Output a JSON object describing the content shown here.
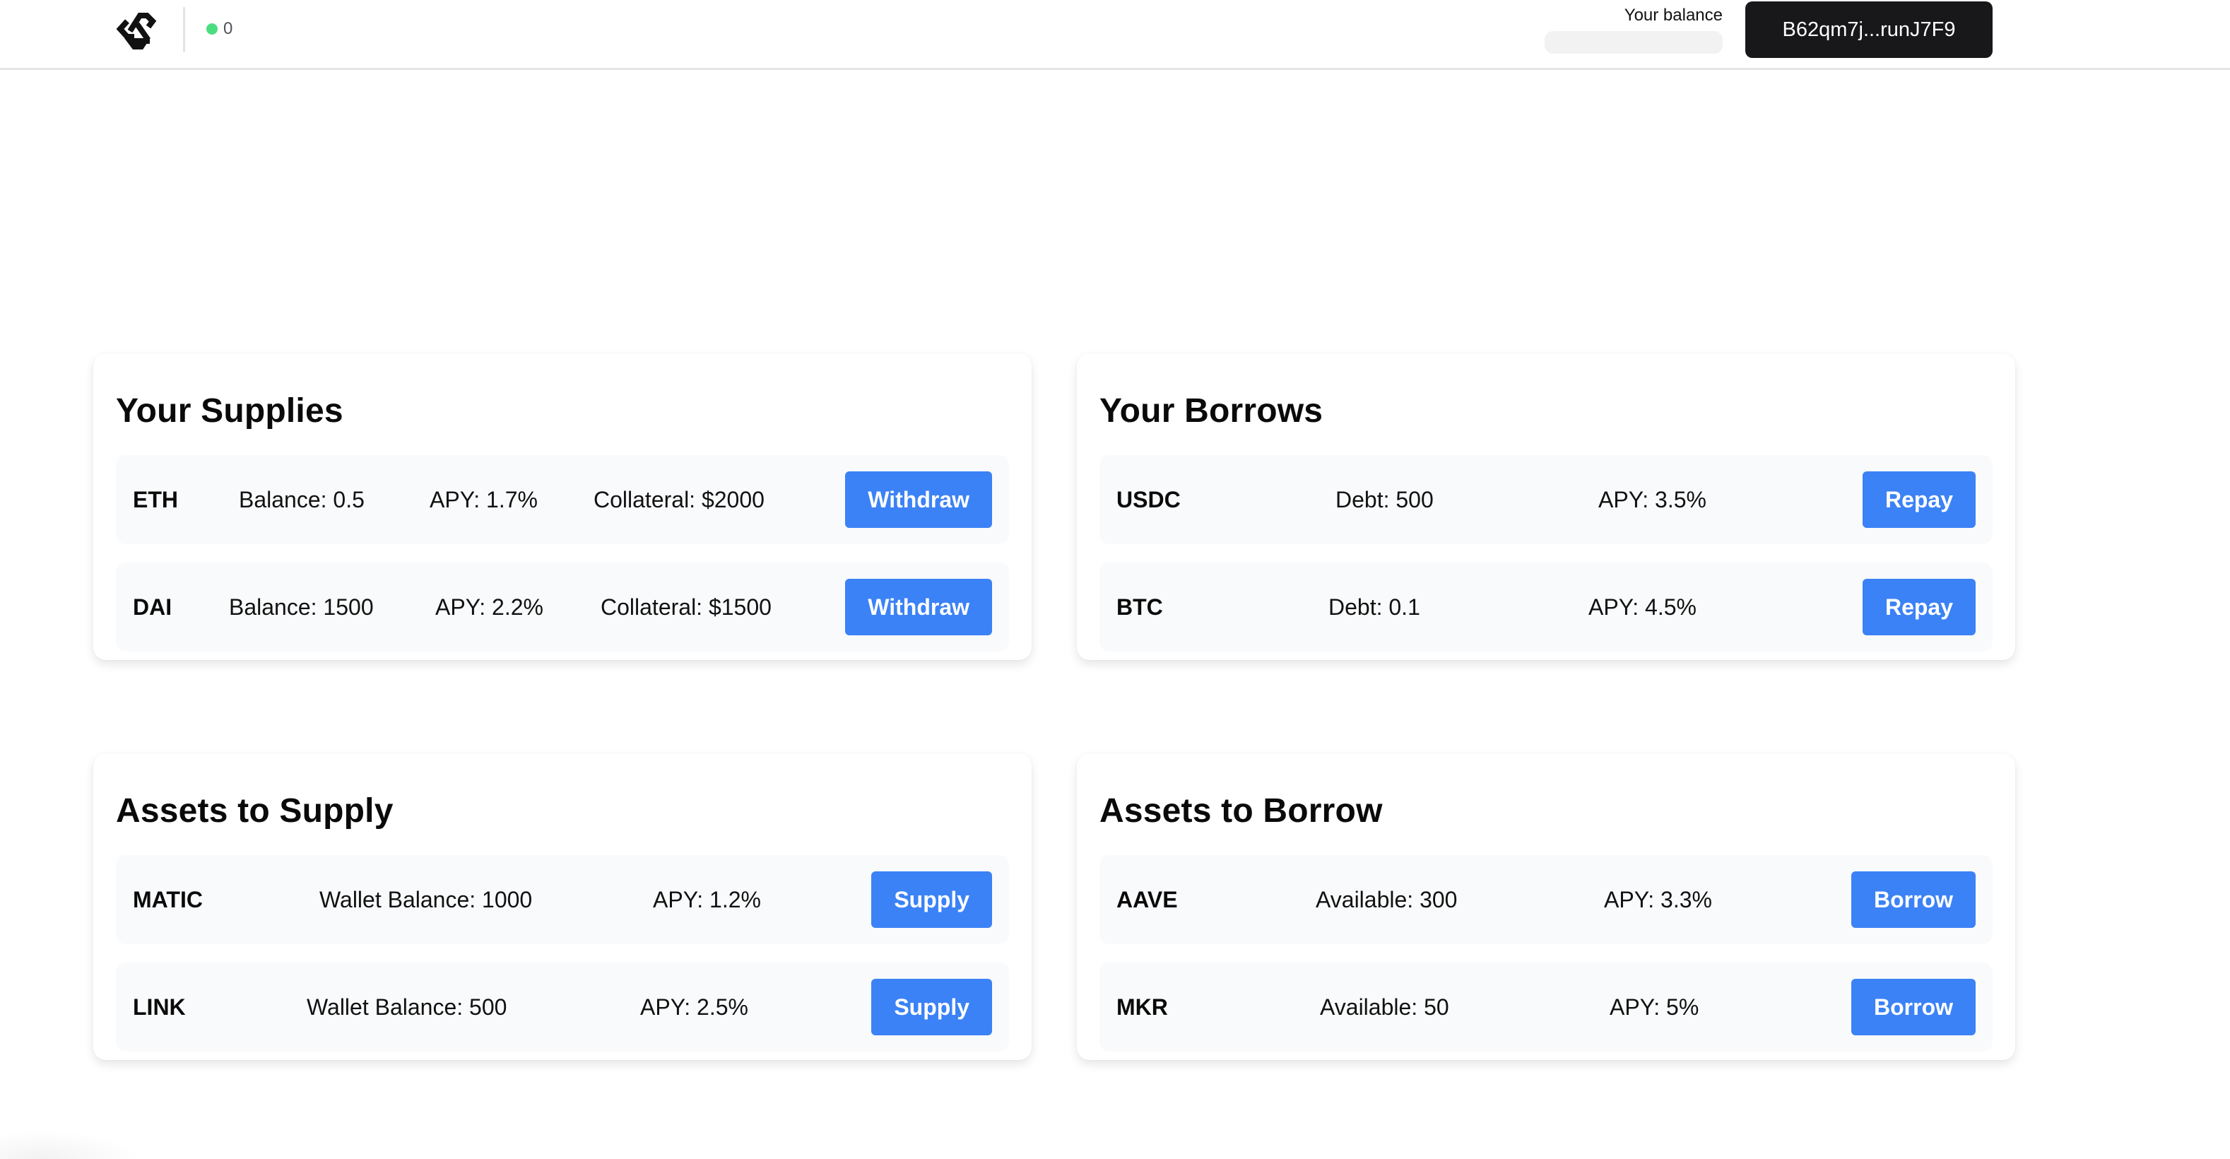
{
  "header": {
    "logo": "app-logo-icon",
    "status": {
      "icon": "status-dot-icon",
      "count": "0",
      "color": "#4ade80"
    },
    "balance_label": "Your balance",
    "wallet_address": "B62qm7j...runJ7F9"
  },
  "colors": {
    "accent": "#3b82f6",
    "wallet_button_bg": "#18181b",
    "row_bg": "#f9fafb"
  },
  "your_supplies": {
    "title": "Your Supplies",
    "rows": [
      {
        "symbol": "ETH",
        "balance": "Balance: 0.5",
        "apy": "APY: 1.7%",
        "collateral": "Collateral: $2000",
        "action": "Withdraw"
      },
      {
        "symbol": "DAI",
        "balance": "Balance: 1500",
        "apy": "APY: 2.2%",
        "collateral": "Collateral: $1500",
        "action": "Withdraw"
      }
    ]
  },
  "your_borrows": {
    "title": "Your Borrows",
    "rows": [
      {
        "symbol": "USDC",
        "debt": "Debt: 500",
        "apy": "APY: 3.5%",
        "action": "Repay"
      },
      {
        "symbol": "BTC",
        "debt": "Debt: 0.1",
        "apy": "APY: 4.5%",
        "action": "Repay"
      }
    ]
  },
  "assets_to_supply": {
    "title": "Assets to Supply",
    "rows": [
      {
        "symbol": "MATIC",
        "wallet_balance": "Wallet Balance: 1000",
        "apy": "APY: 1.2%",
        "action": "Supply"
      },
      {
        "symbol": "LINK",
        "wallet_balance": "Wallet Balance: 500",
        "apy": "APY: 2.5%",
        "action": "Supply"
      }
    ]
  },
  "assets_to_borrow": {
    "title": "Assets to Borrow",
    "rows": [
      {
        "symbol": "AAVE",
        "available": "Available: 300",
        "apy": "APY: 3.3%",
        "action": "Borrow"
      },
      {
        "symbol": "MKR",
        "available": "Available: 50",
        "apy": "APY: 5%",
        "action": "Borrow"
      }
    ]
  }
}
